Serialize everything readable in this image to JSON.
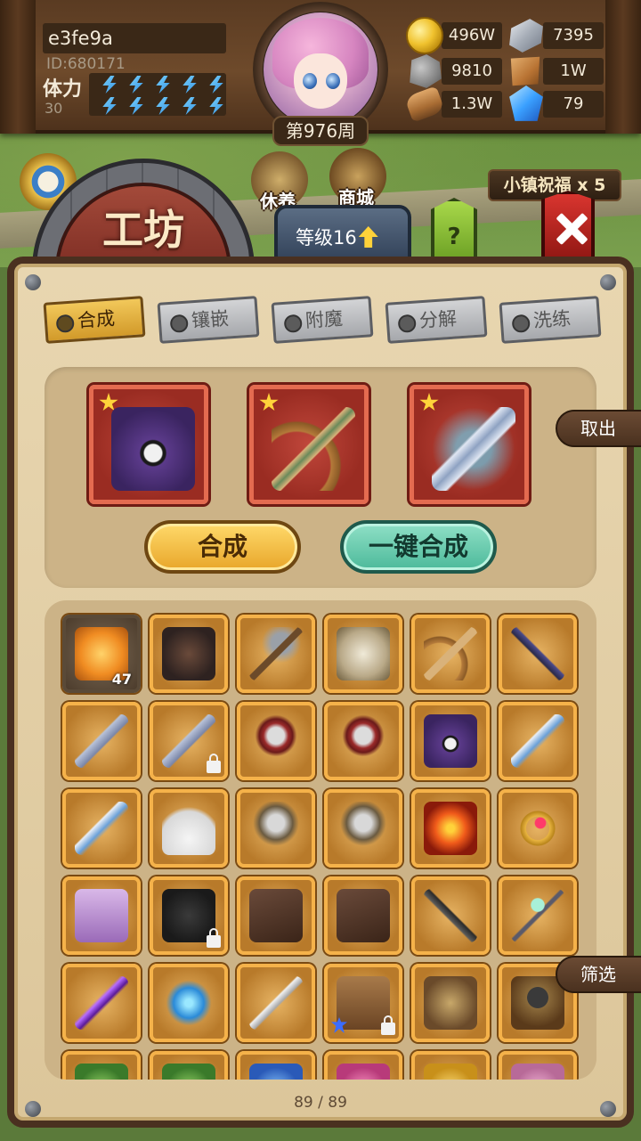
{
  "player": {
    "name": "e3fe9a",
    "id": "ID:680171",
    "stamina_label": "体力",
    "stamina_value": "30",
    "week": "第976周"
  },
  "currencies": [
    {
      "icon": "gold-coin-icon",
      "value": "496W"
    },
    {
      "icon": "silver-ingot-icon",
      "value": "7395"
    },
    {
      "icon": "ore-icon",
      "value": "9810"
    },
    {
      "icon": "leather-icon",
      "value": "1W"
    },
    {
      "icon": "wood-log-icon",
      "value": "1.3W"
    },
    {
      "icon": "crystal-icon",
      "value": "79"
    }
  ],
  "town": {
    "rest_label": "休养",
    "shop_label": "商城",
    "blessing": "小镇祝福 x 5"
  },
  "workshop": {
    "title": "工坊",
    "level": "等级16",
    "help": "?"
  },
  "tabs": [
    {
      "label": "合成",
      "active": true
    },
    {
      "label": "镶嵌",
      "active": false
    },
    {
      "label": "附魔",
      "active": false
    },
    {
      "label": "分解",
      "active": false
    },
    {
      "label": "洗练",
      "active": false
    }
  ],
  "synthesis": {
    "slots": [
      "skull-book",
      "bow",
      "ice-spear"
    ],
    "synth_button": "合成",
    "onekey_button": "一键合成",
    "take_out": "取出",
    "filter": "筛选"
  },
  "inventory": {
    "items": [
      {
        "name": "amber-gem",
        "count": "47"
      },
      {
        "name": "dark-helm"
      },
      {
        "name": "pickaxe"
      },
      {
        "name": "leaf-shield"
      },
      {
        "name": "bow"
      },
      {
        "name": "dark-crossbow"
      },
      {
        "name": "music-flute"
      },
      {
        "name": "music-flute",
        "locked": true
      },
      {
        "name": "battle-axe"
      },
      {
        "name": "battle-axe"
      },
      {
        "name": "skull-book"
      },
      {
        "name": "laser-rifle"
      },
      {
        "name": "laser-rifle"
      },
      {
        "name": "feather-fan"
      },
      {
        "name": "wind-axe"
      },
      {
        "name": "wind-axe"
      },
      {
        "name": "fire-staff"
      },
      {
        "name": "ruby-ring"
      },
      {
        "name": "medkit"
      },
      {
        "name": "spike-armor",
        "locked": true
      },
      {
        "name": "holster"
      },
      {
        "name": "holster"
      },
      {
        "name": "crossbow"
      },
      {
        "name": "jade-scepter"
      },
      {
        "name": "void-dagger"
      },
      {
        "name": "water-orb"
      },
      {
        "name": "long-sword"
      },
      {
        "name": "treasure-chest",
        "locked": true,
        "special": true
      },
      {
        "name": "knight-shield"
      },
      {
        "name": "hood"
      },
      {
        "name": "green-orb"
      },
      {
        "name": "green-orb"
      },
      {
        "name": "blue-wing"
      },
      {
        "name": "pink-horn"
      },
      {
        "name": "gold-crown"
      },
      {
        "name": "pink-shell"
      }
    ],
    "page": "89 / 89"
  }
}
